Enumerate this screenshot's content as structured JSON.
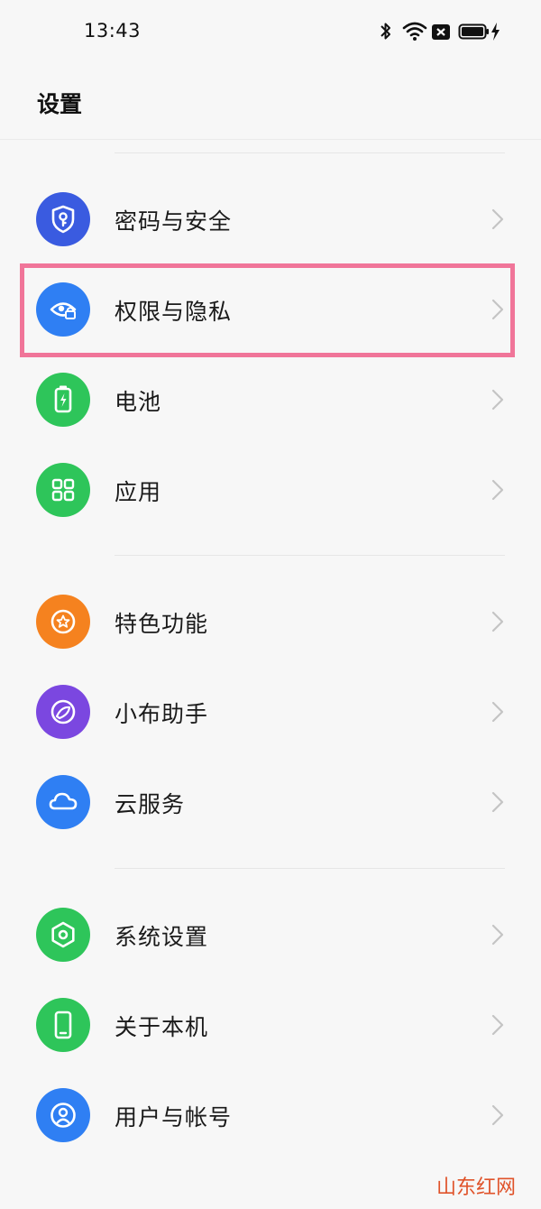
{
  "status_bar": {
    "time": "13:43",
    "icons": [
      "bluetooth-icon",
      "wifi-icon",
      "sim-error-icon",
      "battery-charging-icon"
    ]
  },
  "header": {
    "title": "设置"
  },
  "colors": {
    "blue": "#2f7ff3",
    "indigo": "#3a5be0",
    "green": "#2ec55a",
    "orange": "#f5821f",
    "purple": "#7b47e0",
    "highlight": "#f07599",
    "watermark": "#e0532a"
  },
  "settings": [
    {
      "label": "密码与安全",
      "icon": "shield-key-icon",
      "color": "#3a5be0"
    },
    {
      "label": "权限与隐私",
      "icon": "eye-lock-icon",
      "color": "#2f7ff3",
      "highlighted": true
    },
    {
      "label": "电池",
      "icon": "battery-icon",
      "color": "#2ec55a"
    },
    {
      "label": "应用",
      "icon": "apps-grid-icon",
      "color": "#2ec55a"
    },
    {
      "label": "特色功能",
      "icon": "star-badge-icon",
      "color": "#f5821f"
    },
    {
      "label": "小布助手",
      "icon": "assistant-icon",
      "color": "#7b47e0"
    },
    {
      "label": "云服务",
      "icon": "cloud-icon",
      "color": "#2f7ff3"
    },
    {
      "label": "系统设置",
      "icon": "hexagon-gear-icon",
      "color": "#2ec55a"
    },
    {
      "label": "关于本机",
      "icon": "phone-icon",
      "color": "#2ec55a"
    },
    {
      "label": "用户与帐号",
      "icon": "user-icon",
      "color": "#2f7ff3"
    }
  ],
  "watermark": "山东红网"
}
